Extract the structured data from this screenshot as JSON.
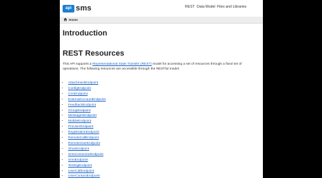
{
  "header": {
    "logo_badge": "api",
    "logo_text": "sms",
    "nav": [
      "REST",
      "Data Model",
      "Files and Libraries"
    ]
  },
  "breadcrumb": {
    "home": "Home"
  },
  "main": {
    "title": "Introduction",
    "section_title": "REST Resources",
    "intro_prefix": "This API supports a ",
    "intro_link": "Representational State Transfer (REST)",
    "intro_suffix": " model for accessing a set of resources through a fixed set of operations. The following resources are accessible through the RESTful model:",
    "resources": [
      "AttachmentEndpoint",
      "ConfigEndpoint",
      "CrmEndpoint",
      "ExternalAccountEndpoint",
      "FeedbackEndpoint",
      "GroupEndpoint",
      "MessagesEndpoint",
      "MobileEndpoint",
      "PmUserEndpoint",
      "RegistrationEndpoint",
      "RemoteCallEndpoint",
      "RemoteUserEndpoint",
      "ShoeEndpoint",
      "SmsConnectorEndpoint",
      "SmsEndpoint",
      "TestingEndpoint",
      "UserCallEndpoint",
      "UserContactEndpoint"
    ]
  },
  "colors": {
    "link": "#1a62c8",
    "logo": "#1d7fd1"
  },
  "icons": {
    "home": "home-icon"
  }
}
